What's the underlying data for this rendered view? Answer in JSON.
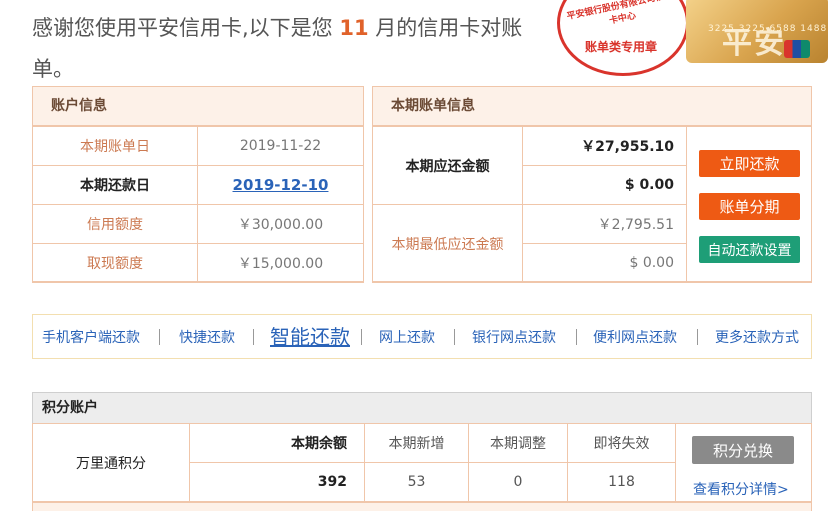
{
  "intro": {
    "prefix": "感谢您使用平安信用卡,以下是您",
    "month": "11",
    "suffix": "月的信用卡对账单。"
  },
  "stamp": {
    "arc_text": "平安银行股份有限公司信用卡中心",
    "center_text": "账单类专用章"
  },
  "card": {
    "logo_text": "平安",
    "number_text": "3225 3225 6588 1488"
  },
  "account_info": {
    "title": "账户信息",
    "rows": [
      {
        "label": "本期账单日",
        "value": "2019-11-22"
      },
      {
        "label": "本期还款日",
        "value": "2019-12-10"
      },
      {
        "label": "信用额度",
        "value": "￥30,000.00"
      },
      {
        "label": "取现额度",
        "value": "￥15,000.00"
      }
    ]
  },
  "bill_info": {
    "title": "本期账单信息",
    "due_label": "本期应还金额",
    "due_amount": "￥27,955.10",
    "due_extra": "$ 0.00",
    "min_label": "本期最低应还金额",
    "min_amount": "￥2,795.51",
    "min_extra": "$ 0.00",
    "btn_repay": "立即还款",
    "btn_installment": "账单分期",
    "btn_auto": "自动还款设置"
  },
  "repay_links": [
    "手机客户端还款",
    "快捷还款",
    "智能还款",
    "网上还款",
    "银行网点还款",
    "便利网点还款",
    "更多还款方式"
  ],
  "points": {
    "title": "积分账户",
    "row_label": "万里通积分",
    "headers": [
      "本期余额",
      "本期新增",
      "本期调整",
      "即将失效"
    ],
    "values": [
      "392",
      "53",
      "0",
      "118"
    ],
    "btn_redeem": "积分兑换",
    "detail_link": "查看积分详情>"
  }
}
